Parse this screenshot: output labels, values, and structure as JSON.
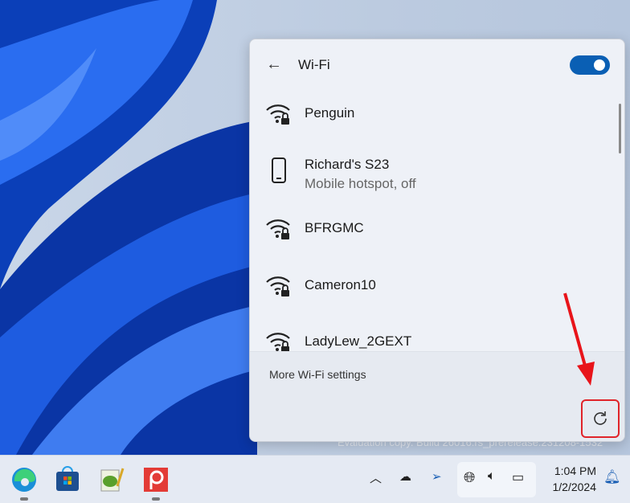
{
  "wifi_panel": {
    "title": "Wi-Fi",
    "toggle_on": true,
    "networks": [
      {
        "name": "Penguin",
        "icon": "wifi-secured-icon"
      },
      {
        "name": "Richard's S23",
        "status": "Mobile hotspot, off",
        "icon": "phone-icon"
      },
      {
        "name": "BFRGMC",
        "icon": "wifi-secured-icon"
      },
      {
        "name": "Cameron10",
        "icon": "wifi-secured-icon"
      },
      {
        "name": "LadyLew_2GEXT",
        "icon": "wifi-secured-icon"
      }
    ],
    "more_settings": "More Wi-Fi settings"
  },
  "watermark": "Evaluation copy. Build 26016.rs_prerelease.231208-1532",
  "taskbar": {
    "apps": [
      "Microsoft Edge",
      "Microsoft Store",
      "Notepad++",
      "Snagit"
    ]
  },
  "clock": {
    "time": "1:04 PM",
    "date": "1/2/2024"
  },
  "colors": {
    "accent": "#0a5fb4",
    "highlight": "#e0242a"
  }
}
